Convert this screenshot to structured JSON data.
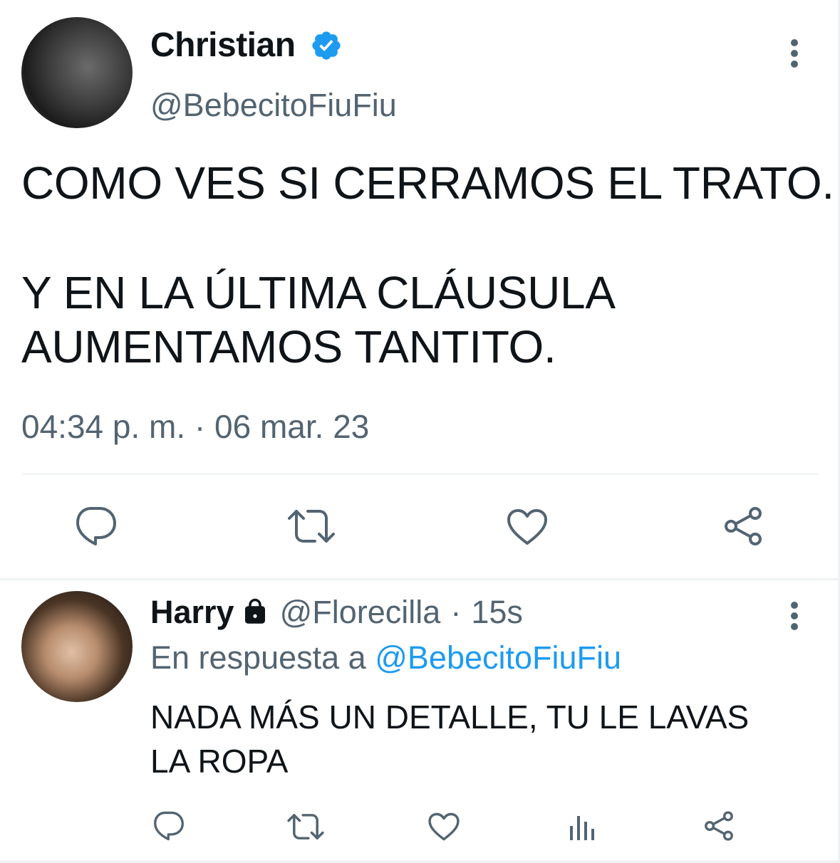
{
  "main_tweet": {
    "display_name": "Christian",
    "verified": true,
    "handle": "@BebecitoFiuFiu",
    "text_lines": [
      "COMO VES SI CERRAMOS EL TRATO.",
      "Y EN LA ÚLTIMA CLÁUSULA",
      "AUMENTAMOS TANTITO."
    ],
    "timestamp": "04:34 p. m. · 06 mar. 23",
    "actions": [
      "reply-icon",
      "retweet-icon",
      "like-icon",
      "share-icon"
    ]
  },
  "reply_tweet": {
    "display_name": "Harry",
    "protected": true,
    "handle": "@Florecilla",
    "separator": "·",
    "time_ago": "15s",
    "in_reply_prefix": "En respuesta a",
    "in_reply_handle": "@BebecitoFiuFiu",
    "text_lines": [
      "NADA MÁS UN DETALLE, TU LE LAVAS",
      "LA ROPA"
    ],
    "actions": [
      "reply-icon",
      "retweet-icon",
      "like-icon",
      "analytics-icon",
      "share-icon"
    ]
  },
  "colors": {
    "text_primary": "#0f1419",
    "text_secondary": "#536471",
    "link": "#1d9bf0",
    "verified_badge": "#1d9bf0",
    "divider": "#eff3f4"
  }
}
